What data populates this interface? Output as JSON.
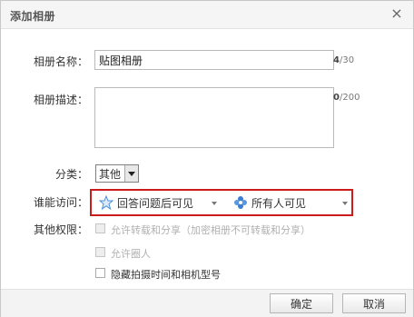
{
  "dialog": {
    "title": "添加相册",
    "close_glyph": "×"
  },
  "form": {
    "name_label": "相册名称：",
    "name_value": "贴图相册",
    "name_count": "4",
    "name_max": "/30",
    "desc_label": "相册描述：",
    "desc_value": "",
    "desc_count": "0",
    "desc_max": "/200",
    "category_label": "分类：",
    "category_value": "其他",
    "access_label": "谁能访问：",
    "access_option1": "回答问题后可见",
    "access_option2": "所有人可见",
    "other_label": "其他权限：",
    "options": [
      {
        "label": "允许转载和分享（加密相册不可转载和分享）",
        "checked": false,
        "disabled": true
      },
      {
        "label": "允许圈人",
        "checked": false,
        "disabled": true
      },
      {
        "label": "隐藏拍摄时间和相机型号",
        "checked": false,
        "disabled": false
      }
    ]
  },
  "footer": {
    "ok_label": "确定",
    "cancel_label": "取消"
  },
  "colors": {
    "highlight": "#cc1b1b",
    "star": "#4a90d9",
    "flower": "#3b7fd1"
  },
  "icons": [
    "close-icon",
    "star-icon",
    "flower-icon",
    "chevron-down-icon"
  ]
}
